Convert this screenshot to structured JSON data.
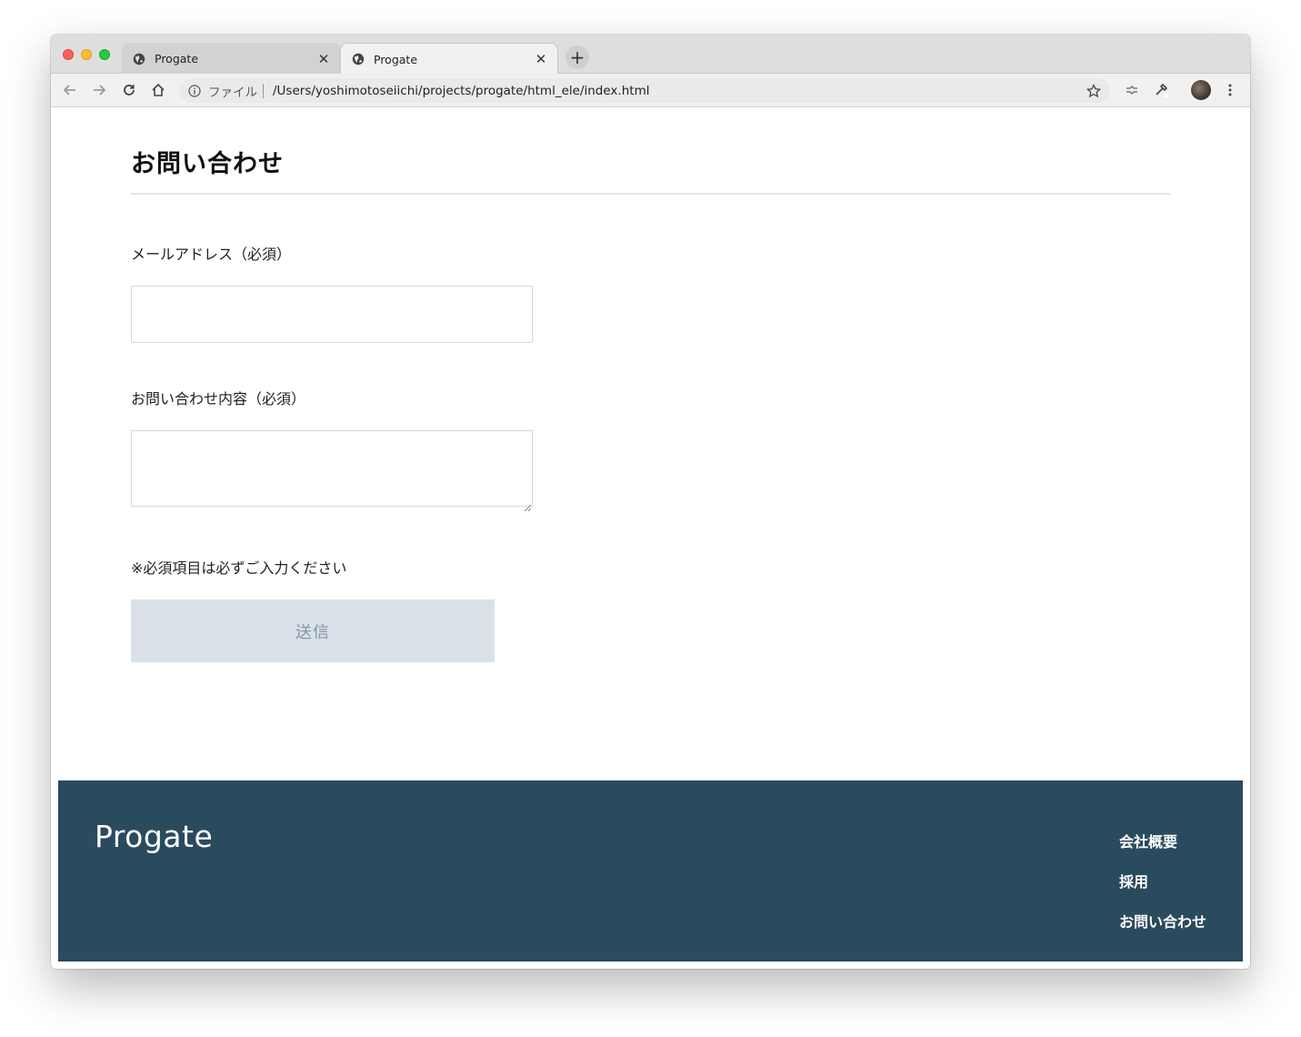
{
  "browser": {
    "tabs": [
      {
        "title": "Progate",
        "active": false
      },
      {
        "title": "Progate",
        "active": true
      }
    ],
    "newtab_label": "+",
    "close_glyph": "✕",
    "address": {
      "scheme_label": "ファイル",
      "url": "/Users/yoshimotoseiichi/projects/progate/html_ele/index.html"
    }
  },
  "main": {
    "title": "お問い合わせ",
    "email_label": "メールアドレス（必須）",
    "message_label": "お問い合わせ内容（必須）",
    "note": "※必須項目は必ずご入力ください",
    "submit_label": "送信"
  },
  "footer": {
    "logo": "Progate",
    "links": [
      "会社概要",
      "採用",
      "お問い合わせ"
    ]
  },
  "colors": {
    "footer_bg": "#2a4a5e",
    "submit_bg": "#dae1e8",
    "submit_text": "#8496a6"
  }
}
